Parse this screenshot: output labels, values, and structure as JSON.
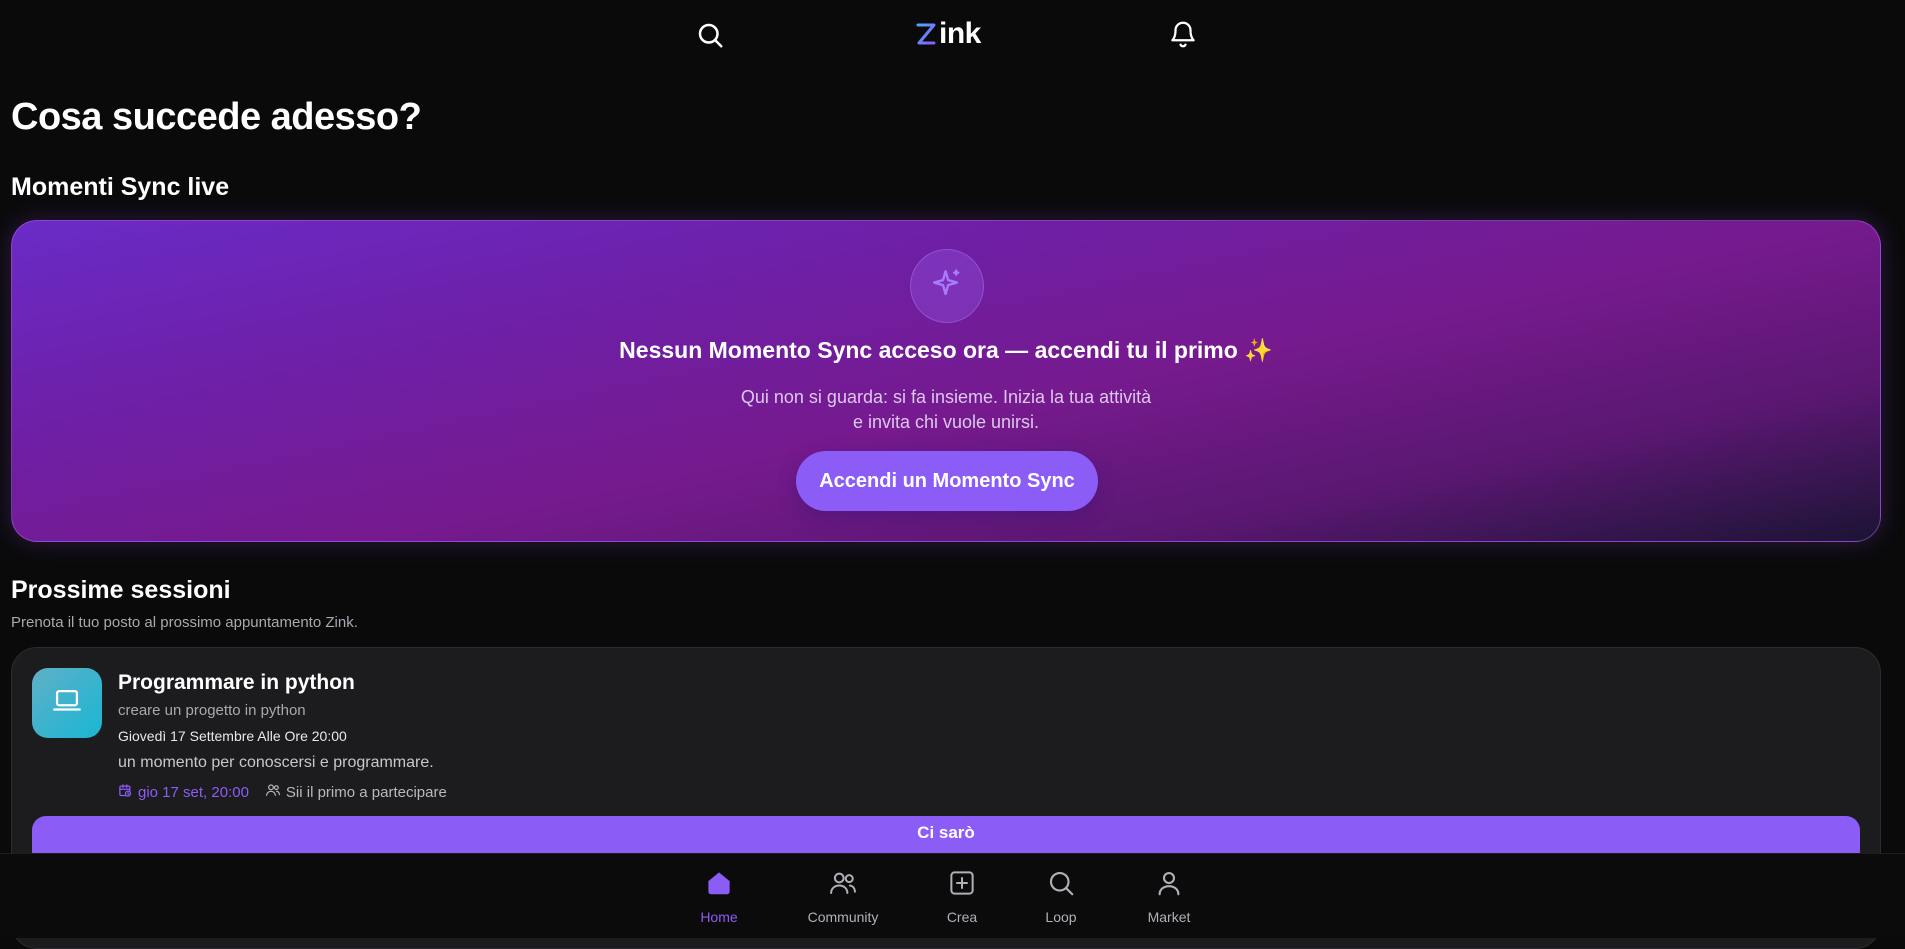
{
  "header": {
    "logo_text": "ink",
    "search_icon": "search-icon",
    "bell_icon": "bell-icon"
  },
  "page": {
    "title": "Cosa succede adesso?"
  },
  "sync": {
    "section_title": "Momenti Sync live",
    "badge_icon": "sparkle-icon",
    "heading": "Nessun Momento Sync acceso ora — accendi tu il primo ✨",
    "desc_line1": "Qui non si guarda: si fa insieme. Inizia la tua attività",
    "desc_line2": "e invita chi vuole unirsi.",
    "cta_label": "Accendi un Momento Sync"
  },
  "sessions": {
    "title": "Prossime sessioni",
    "subtitle": "Prenota il tuo posto al prossimo appuntamento Zink.",
    "items": [
      {
        "icon": "laptop-icon",
        "name": "Programmare in python",
        "description": "creare un progetto in python",
        "when": "Giovedì 17 Settembre Alle Ore 20:00",
        "note": "un momento per conoscersi e programmare.",
        "date_chip": "gio 17 set, 20:00",
        "participants": "Sii il primo a partecipare",
        "cta_label": "Ci sarò"
      }
    ]
  },
  "bottom_nav": {
    "items": [
      {
        "label": "Home",
        "icon": "home-icon",
        "active": true
      },
      {
        "label": "Community",
        "icon": "people-icon",
        "active": false
      },
      {
        "label": "Crea",
        "icon": "plus-square-icon",
        "active": false
      },
      {
        "label": "Loop",
        "icon": "search-icon",
        "active": false
      },
      {
        "label": "Market",
        "icon": "user-icon",
        "active": false
      }
    ]
  },
  "colors": {
    "accent": "#8b5cf6",
    "background": "#0a0a0b",
    "card": "#1c1c1e"
  }
}
